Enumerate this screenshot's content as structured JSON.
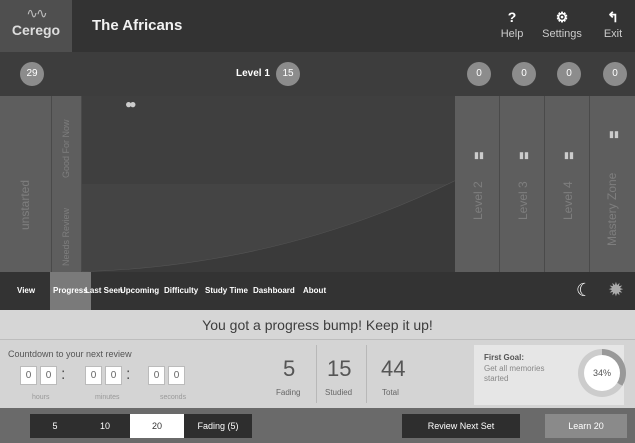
{
  "app": {
    "logo": "Cerego",
    "title": "The Africans"
  },
  "toolbar": {
    "help": "Help",
    "settings": "Settings",
    "exit": "Exit"
  },
  "levels": {
    "left_count": "29",
    "label": "Level 1",
    "level1_count": "15",
    "c2": "0",
    "c3": "0",
    "c4": "0",
    "c5": "0"
  },
  "columns": {
    "unstarted": "unstarted",
    "good_for_now": "Good For Now",
    "needs_review": "Needs Review",
    "level2": "Level 2",
    "level3": "Level 3",
    "level4": "Level 4",
    "mastery": "Mastery Zone"
  },
  "viewtabs": {
    "view": "View",
    "progress": "Progress",
    "last_seen": "Last Seen",
    "upcoming": "Upcoming",
    "difficulty": "Difficulty",
    "study_time": "Study Time",
    "dashboard": "Dashboard",
    "about": "About"
  },
  "banner": "You got a progress bump! Keep it up!",
  "countdown": {
    "label": "Countdown to your next review",
    "hours": "hours",
    "minutes": "minutes",
    "seconds": "seconds",
    "digits": [
      "0",
      "0",
      "0",
      "0",
      "0",
      "0"
    ]
  },
  "stats": {
    "fading_num": "5",
    "fading_label": "Fading",
    "studied_num": "15",
    "studied_label": "Studied",
    "total_num": "44",
    "total_label": "Total"
  },
  "goal": {
    "title": "First Goal:",
    "desc": "Get all memories started",
    "percent": "34%",
    "progress": 0.34
  },
  "bottom": {
    "b5": "5",
    "b10": "10",
    "b20": "20",
    "fading": "Fading (5)",
    "review": "Review Next Set",
    "learn": "Learn 20"
  }
}
